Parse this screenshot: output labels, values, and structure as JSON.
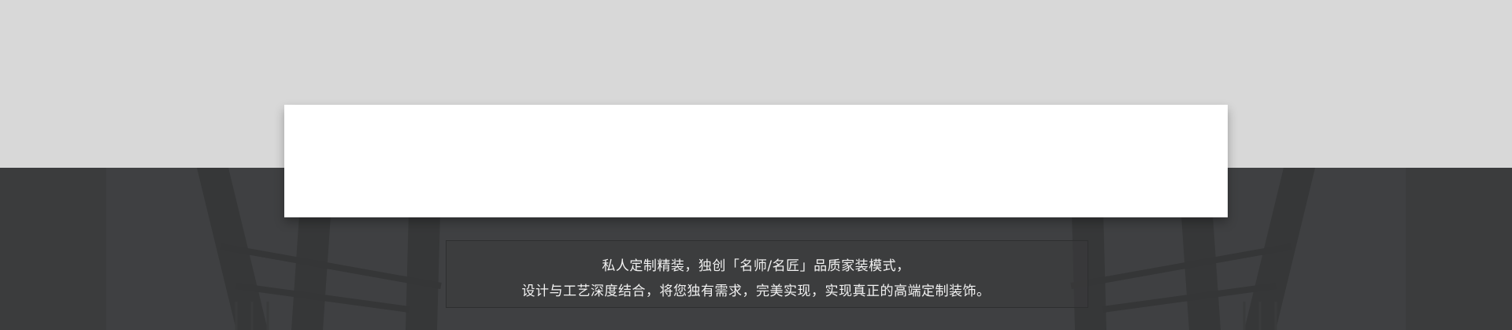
{
  "banner": {
    "tagline_line1": "私人定制精装，独创「名师/名匠」品质家装模式，",
    "tagline_line2": "设计与工艺深度结合，将您独有需求，完美实现，实现真正的高端定制装饰。"
  },
  "colors": {
    "top_band": "#d8d8d8",
    "dark_band": "#414244",
    "card": "#ffffff",
    "caption_text": "#f2f2f2"
  }
}
